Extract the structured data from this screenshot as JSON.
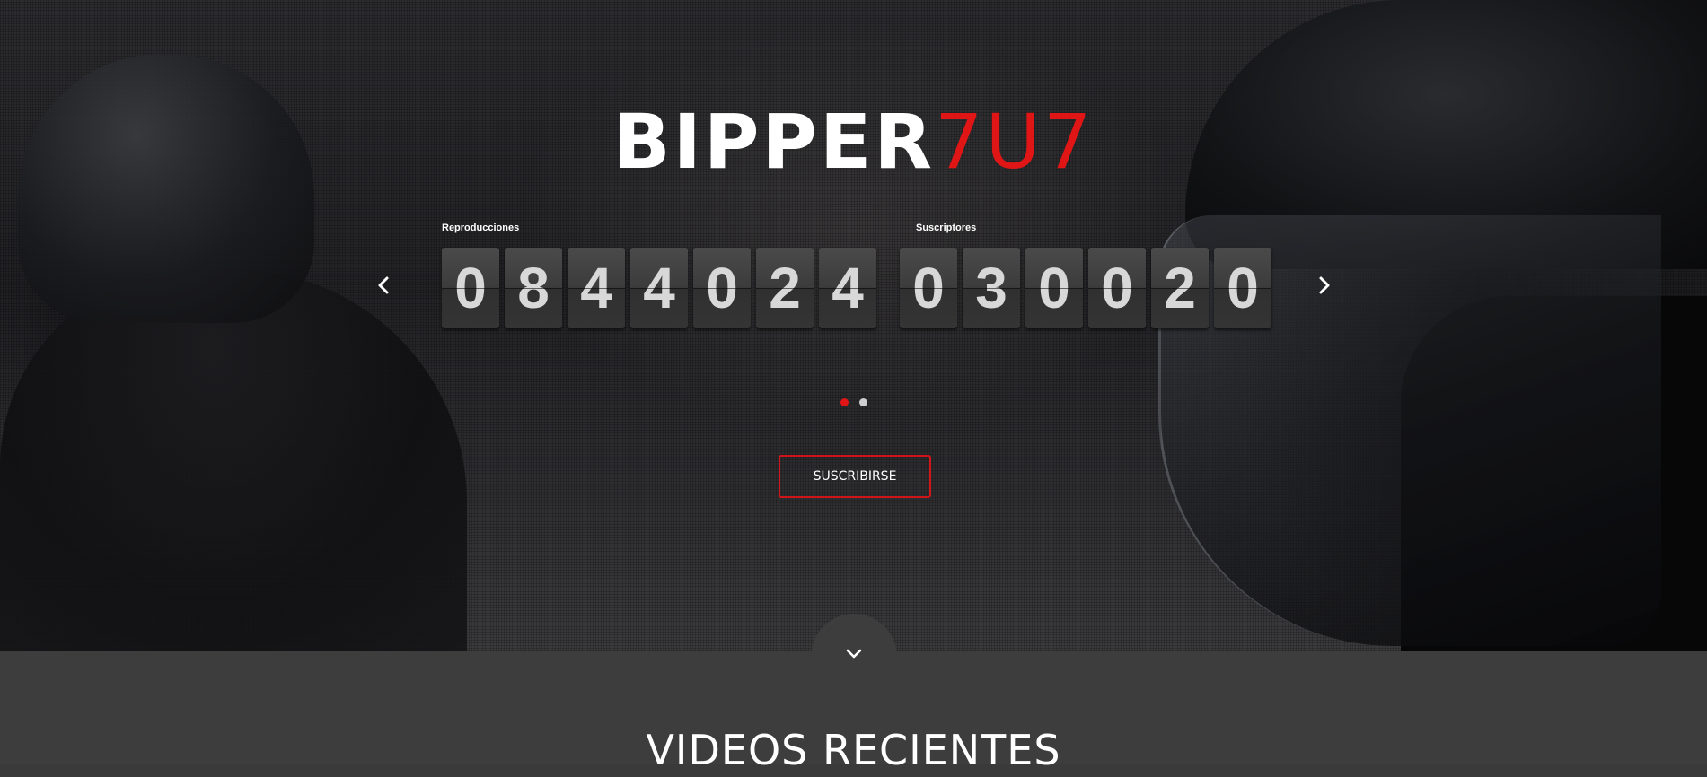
{
  "brand": {
    "name_main": "BIPPER",
    "name_accent": "7U7",
    "accent_color": "#e01616"
  },
  "counters": {
    "views": {
      "label": "Reproducciones",
      "digits": [
        "0",
        "8",
        "4",
        "4",
        "0",
        "2",
        "4"
      ]
    },
    "subscribers": {
      "label": "Suscriptores",
      "digits": [
        "0",
        "3",
        "0",
        "0",
        "2",
        "0"
      ]
    }
  },
  "carousel": {
    "prev_icon": "chevron-left-icon",
    "next_icon": "chevron-right-icon",
    "slides": 2,
    "active_slide": 1
  },
  "cta": {
    "subscribe_label": "SUSCRIBIRSE"
  },
  "scroll": {
    "icon": "chevron-down-icon"
  },
  "sections": {
    "recent_videos_title": "VIDEOS RECIENTES"
  }
}
